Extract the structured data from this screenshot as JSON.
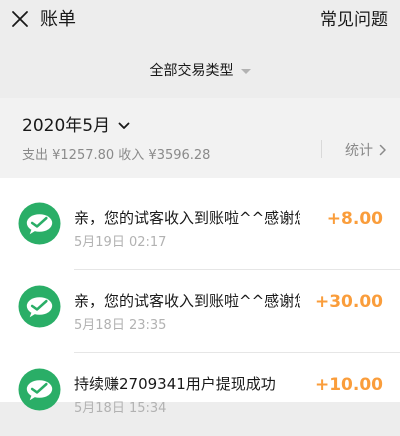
{
  "header": {
    "title": "账单",
    "faq_label": "常见问题"
  },
  "filter": {
    "label": "全部交易类型"
  },
  "month": {
    "label": "2020年5月",
    "summary": "支出 ¥1257.80 收入 ¥3596.28",
    "stats_label": "统计"
  },
  "transactions": [
    {
      "title": "亲，您的试客收入到账啦^^感谢您的支持",
      "time": "5月19日 02:17",
      "amount": "+8.00"
    },
    {
      "title": "亲，您的试客收入到账啦^^感谢您的支持",
      "time": "5月18日 23:35",
      "amount": "+30.00"
    },
    {
      "title": "持续赚2709341用户提现成功",
      "time": "5月18日 15:34",
      "amount": "+10.00"
    }
  ],
  "colors": {
    "background": "#ededed",
    "income": "#fa9d3b",
    "wechat_green": "#2aae67"
  },
  "icons": {
    "close": "close-icon",
    "filter": "caret-down-icon",
    "month": "chevron-down-icon",
    "stats": "chevron-right-icon",
    "avatar": "wechat-pay-icon"
  }
}
